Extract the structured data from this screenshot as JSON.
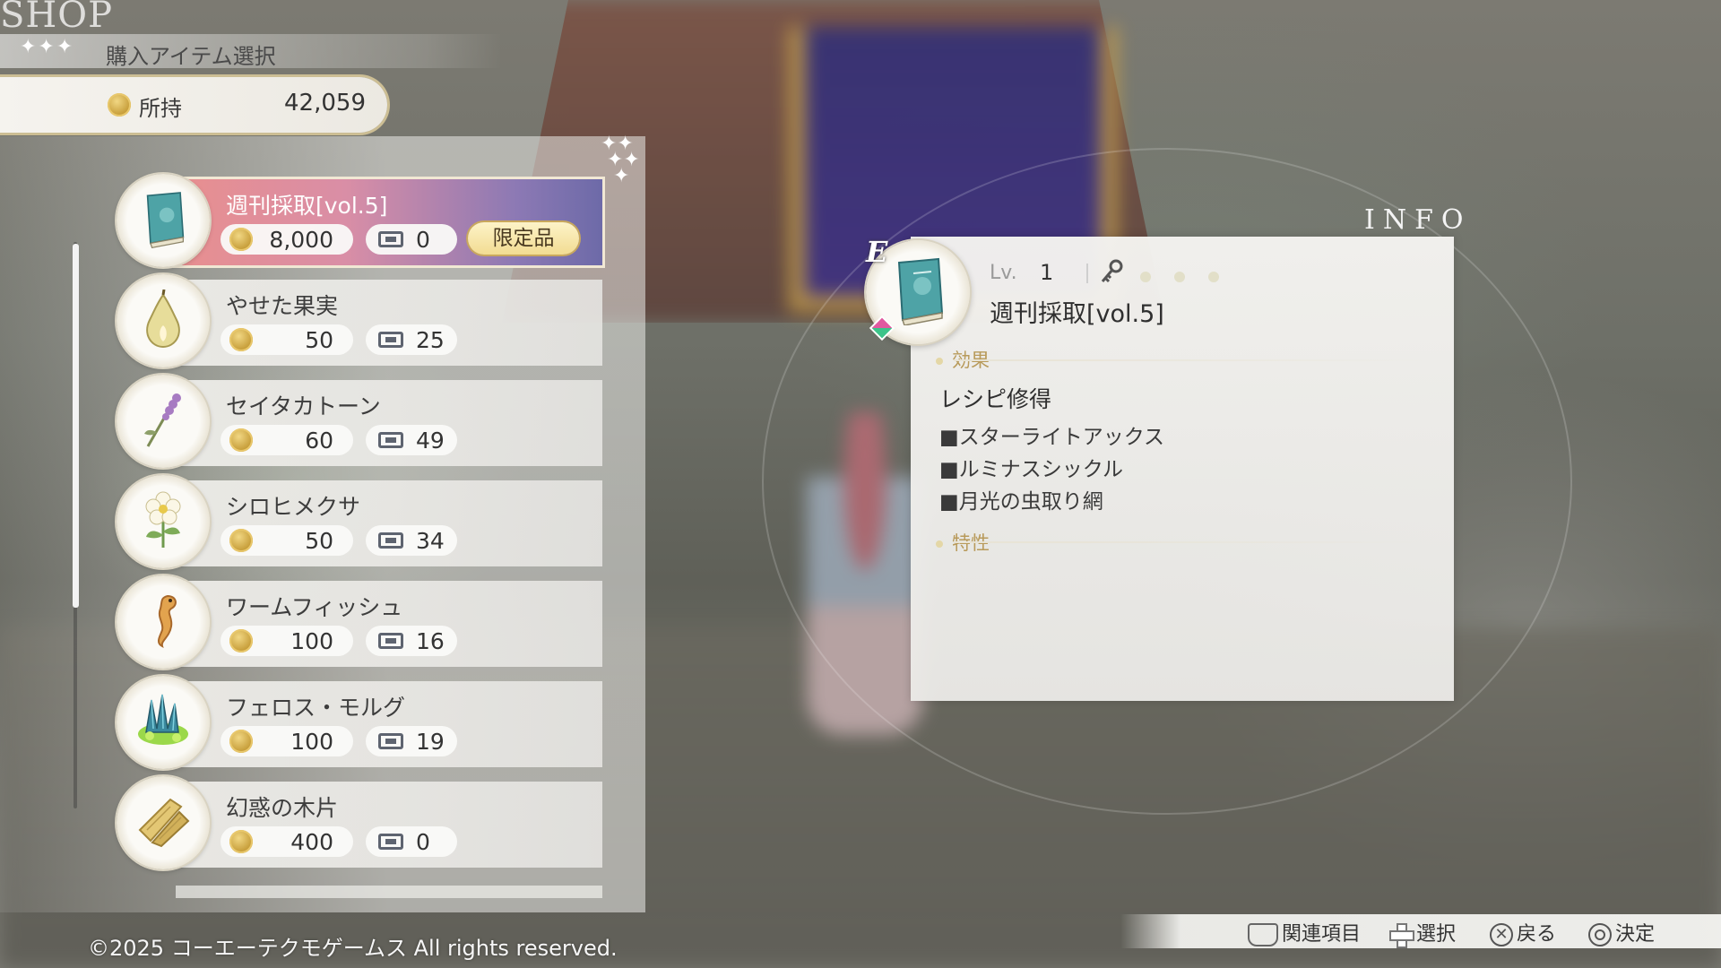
{
  "header": {
    "shop_title": "SHOP",
    "stars": "✦✦✦",
    "subtitle": "購入アイテム選択"
  },
  "wallet": {
    "label": "所持",
    "amount": "42,059"
  },
  "item_list": {
    "scroll_position": 0,
    "items": [
      {
        "name": "週刊採取[vol.5]",
        "price": "8,000",
        "stock": "0",
        "badge": "限定品",
        "selected": true,
        "icon": "book-icon"
      },
      {
        "name": "やせた果実",
        "price": "50",
        "stock": "25",
        "selected": false,
        "icon": "pear-icon"
      },
      {
        "name": "セイタカトーン",
        "price": "60",
        "stock": "49",
        "selected": false,
        "icon": "lavender-icon"
      },
      {
        "name": "シロヒメクサ",
        "price": "50",
        "stock": "34",
        "selected": false,
        "icon": "white-flower-icon"
      },
      {
        "name": "ワームフィッシュ",
        "price": "100",
        "stock": "16",
        "selected": false,
        "icon": "seahorse-icon"
      },
      {
        "name": "フェロス・モルグ",
        "price": "100",
        "stock": "19",
        "selected": false,
        "icon": "green-crystal-icon"
      },
      {
        "name": "幻惑の木片",
        "price": "400",
        "stock": "0",
        "selected": false,
        "icon": "wood-chip-icon"
      }
    ]
  },
  "info": {
    "title": "INFO",
    "equip_mark": "E",
    "level_label": "Lv.",
    "level": "1",
    "item_name": "週刊採取[vol.5]",
    "effect_heading": "効果",
    "effect_main": "レシピ修得",
    "effect_items": [
      "■スターライトアックス",
      "■ルミナスシックル",
      "■月光の虫取り網"
    ],
    "trait_heading": "特性"
  },
  "footer": {
    "copyright": "©2025 コーエーテクモゲームス All rights reserved.",
    "controls": [
      {
        "label": "関連項目",
        "icon": "touchpad-icon"
      },
      {
        "label": "選択",
        "icon": "dpad-icon"
      },
      {
        "label": "戻る",
        "icon": "cross-button-icon"
      },
      {
        "label": "決定",
        "icon": "circle-button-icon"
      }
    ]
  },
  "colors": {
    "selected_row_start": "#e88f8f",
    "selected_row_end": "#6d6aa8",
    "accent_gold": "#c9a85c"
  }
}
